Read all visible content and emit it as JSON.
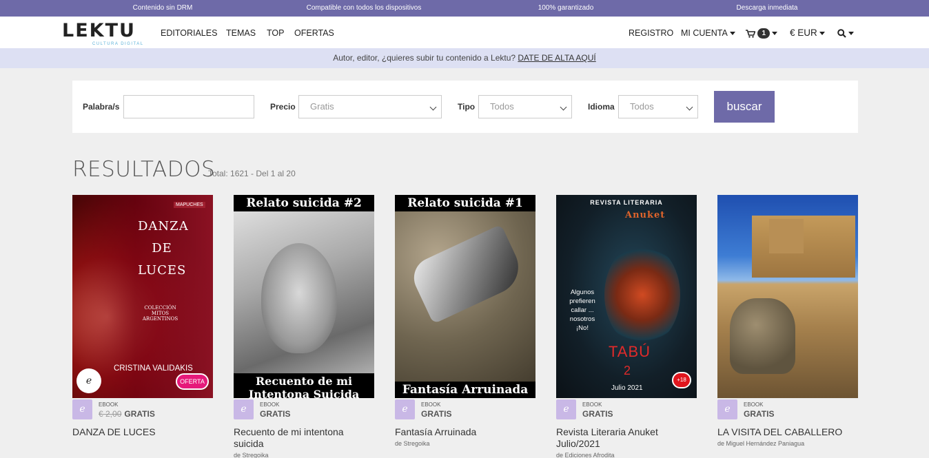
{
  "topbar": [
    "Contenido sin DRM",
    "Compatible con todos los dispositivos",
    "100% garantizado",
    "Descarga inmediata"
  ],
  "logo": {
    "text": "LEKTU",
    "sub": "CULTURA DIGITAL"
  },
  "nav": {
    "editoriales": "EDITORIALES",
    "temas": "TEMAS",
    "top": "TOP",
    "ofertas": "OFERTAS",
    "registro": "REGISTRO",
    "mi_cuenta": "MI CUENTA",
    "cart_count": "1",
    "currency": "€ EUR"
  },
  "promo": {
    "text": "Autor, editor, ¿quieres subir tu contenido a Lektu? ",
    "link": "DATE DE ALTA AQUÍ"
  },
  "search": {
    "palabra_label": "Palabra/s",
    "palabra_value": "",
    "precio_label": "Precio",
    "precio_value": "Gratis",
    "tipo_label": "Tipo",
    "tipo_value": "Todos",
    "idioma_label": "Idioma",
    "idioma_value": "Todos",
    "button": "buscar"
  },
  "results": {
    "title": "RESULTADOS",
    "summary": "Total: 1621 - Del 1 al 20"
  },
  "books": [
    {
      "title": "DANZA DE LUCES",
      "type": "EBOOK",
      "old_price": "€ 2,00",
      "price": "GRATIS",
      "author": "",
      "cover_title": "DANZA DE LUCES",
      "cover_author": "CRISTINA VALIDAKIS",
      "cover_sub": "COLECCIÓN MITOS ARGENTINOS",
      "cover_tag": "MAPUCHES",
      "badge": "OFERTA"
    },
    {
      "title": "Recuento de mi intentona suicida",
      "type": "EBOOK",
      "old_price": "",
      "price": "GRATIS",
      "author": "de Stregoika",
      "cover_top": "Relato suicida #2",
      "cover_bottom": "Recuento de mi Intentona Suicida"
    },
    {
      "title": "Fantasía Arruinada",
      "type": "EBOOK",
      "old_price": "",
      "price": "GRATIS",
      "author": "de Stregoika",
      "cover_top": "Relato suicida #1",
      "cover_bottom": "Fantasía Arruinada"
    },
    {
      "title": "Revista Literaria Anuket Julio/2021",
      "type": "EBOOK",
      "old_price": "",
      "price": "GRATIS",
      "author": "de Ediciones Afrodita",
      "cover_top": "REVISTA LITERARIA",
      "cover_brand": "Anuket",
      "cover_quote": "Algunos prefieren callar ... nosotros ¡No!",
      "cover_main": "TABÚ",
      "cover_num": "2",
      "cover_date": "Julio 2021",
      "badge": "+18"
    },
    {
      "title": "LA VISITA DEL CABALLERO",
      "type": "EBOOK",
      "old_price": "",
      "price": "GRATIS",
      "author": "de Miguel Hernández Paniagua"
    }
  ]
}
